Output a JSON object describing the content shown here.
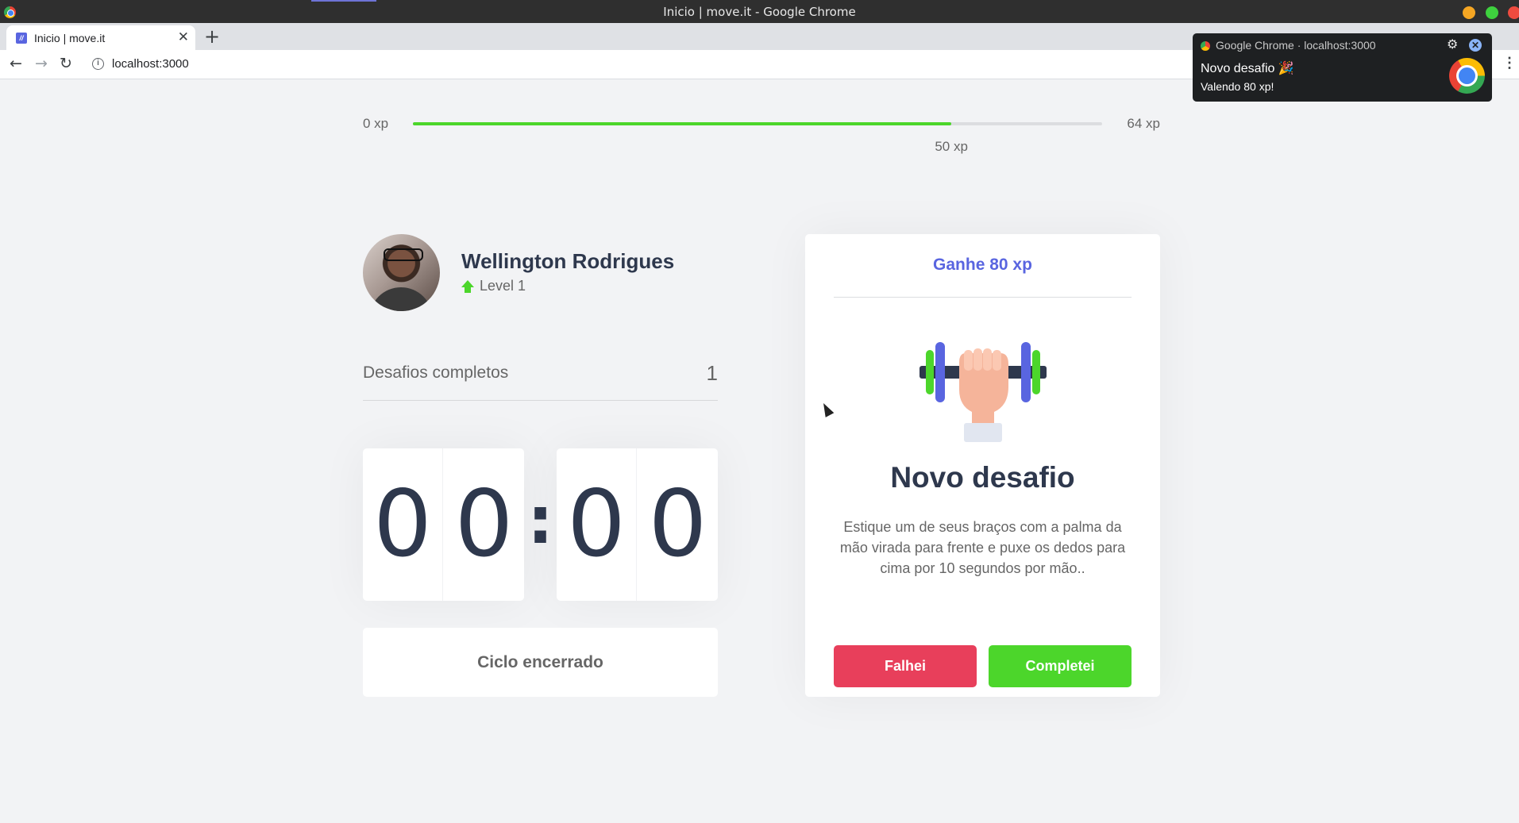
{
  "window": {
    "title": "Inicio | move.it - Google Chrome"
  },
  "tab": {
    "title": "Inicio | move.it",
    "close_glyph": "✕",
    "new_tab_glyph": "+"
  },
  "address_bar": {
    "url": "localhost:3000",
    "info_glyph": "i"
  },
  "notification": {
    "source": "Google Chrome · localhost:3000",
    "title": "Novo desafio 🎉",
    "body": "Valendo 80 xp!"
  },
  "experience_bar": {
    "min_label": "0 xp",
    "max_label": "64 xp",
    "current_label": "50 xp",
    "current": 50,
    "max": 64,
    "fill_color": "#4cd62b"
  },
  "profile": {
    "name": "Wellington Rodrigues",
    "level_label": "Level 1",
    "level_icon": "level-up-arrow-icon"
  },
  "completed_challenges": {
    "label": "Desafios completos",
    "count": "1"
  },
  "countdown": {
    "minute_left": "0",
    "minute_right": "0",
    "separator": ":",
    "second_left": "0",
    "second_right": "0"
  },
  "cycle_button": {
    "label": "Ciclo encerrado"
  },
  "challenge": {
    "header": "Ganhe 80 xp",
    "illustration": "dumbbell-hand-icon",
    "title": "Novo desafio",
    "description": "Estique um de seus braços com a palma da mão virada para frente e puxe os dedos para cima por 10 segundos por mão..",
    "fail_label": "Falhei",
    "success_label": "Completei",
    "fail_color": "#e83f5b",
    "success_color": "#4cd62b",
    "accent_color": "#5965e0"
  }
}
